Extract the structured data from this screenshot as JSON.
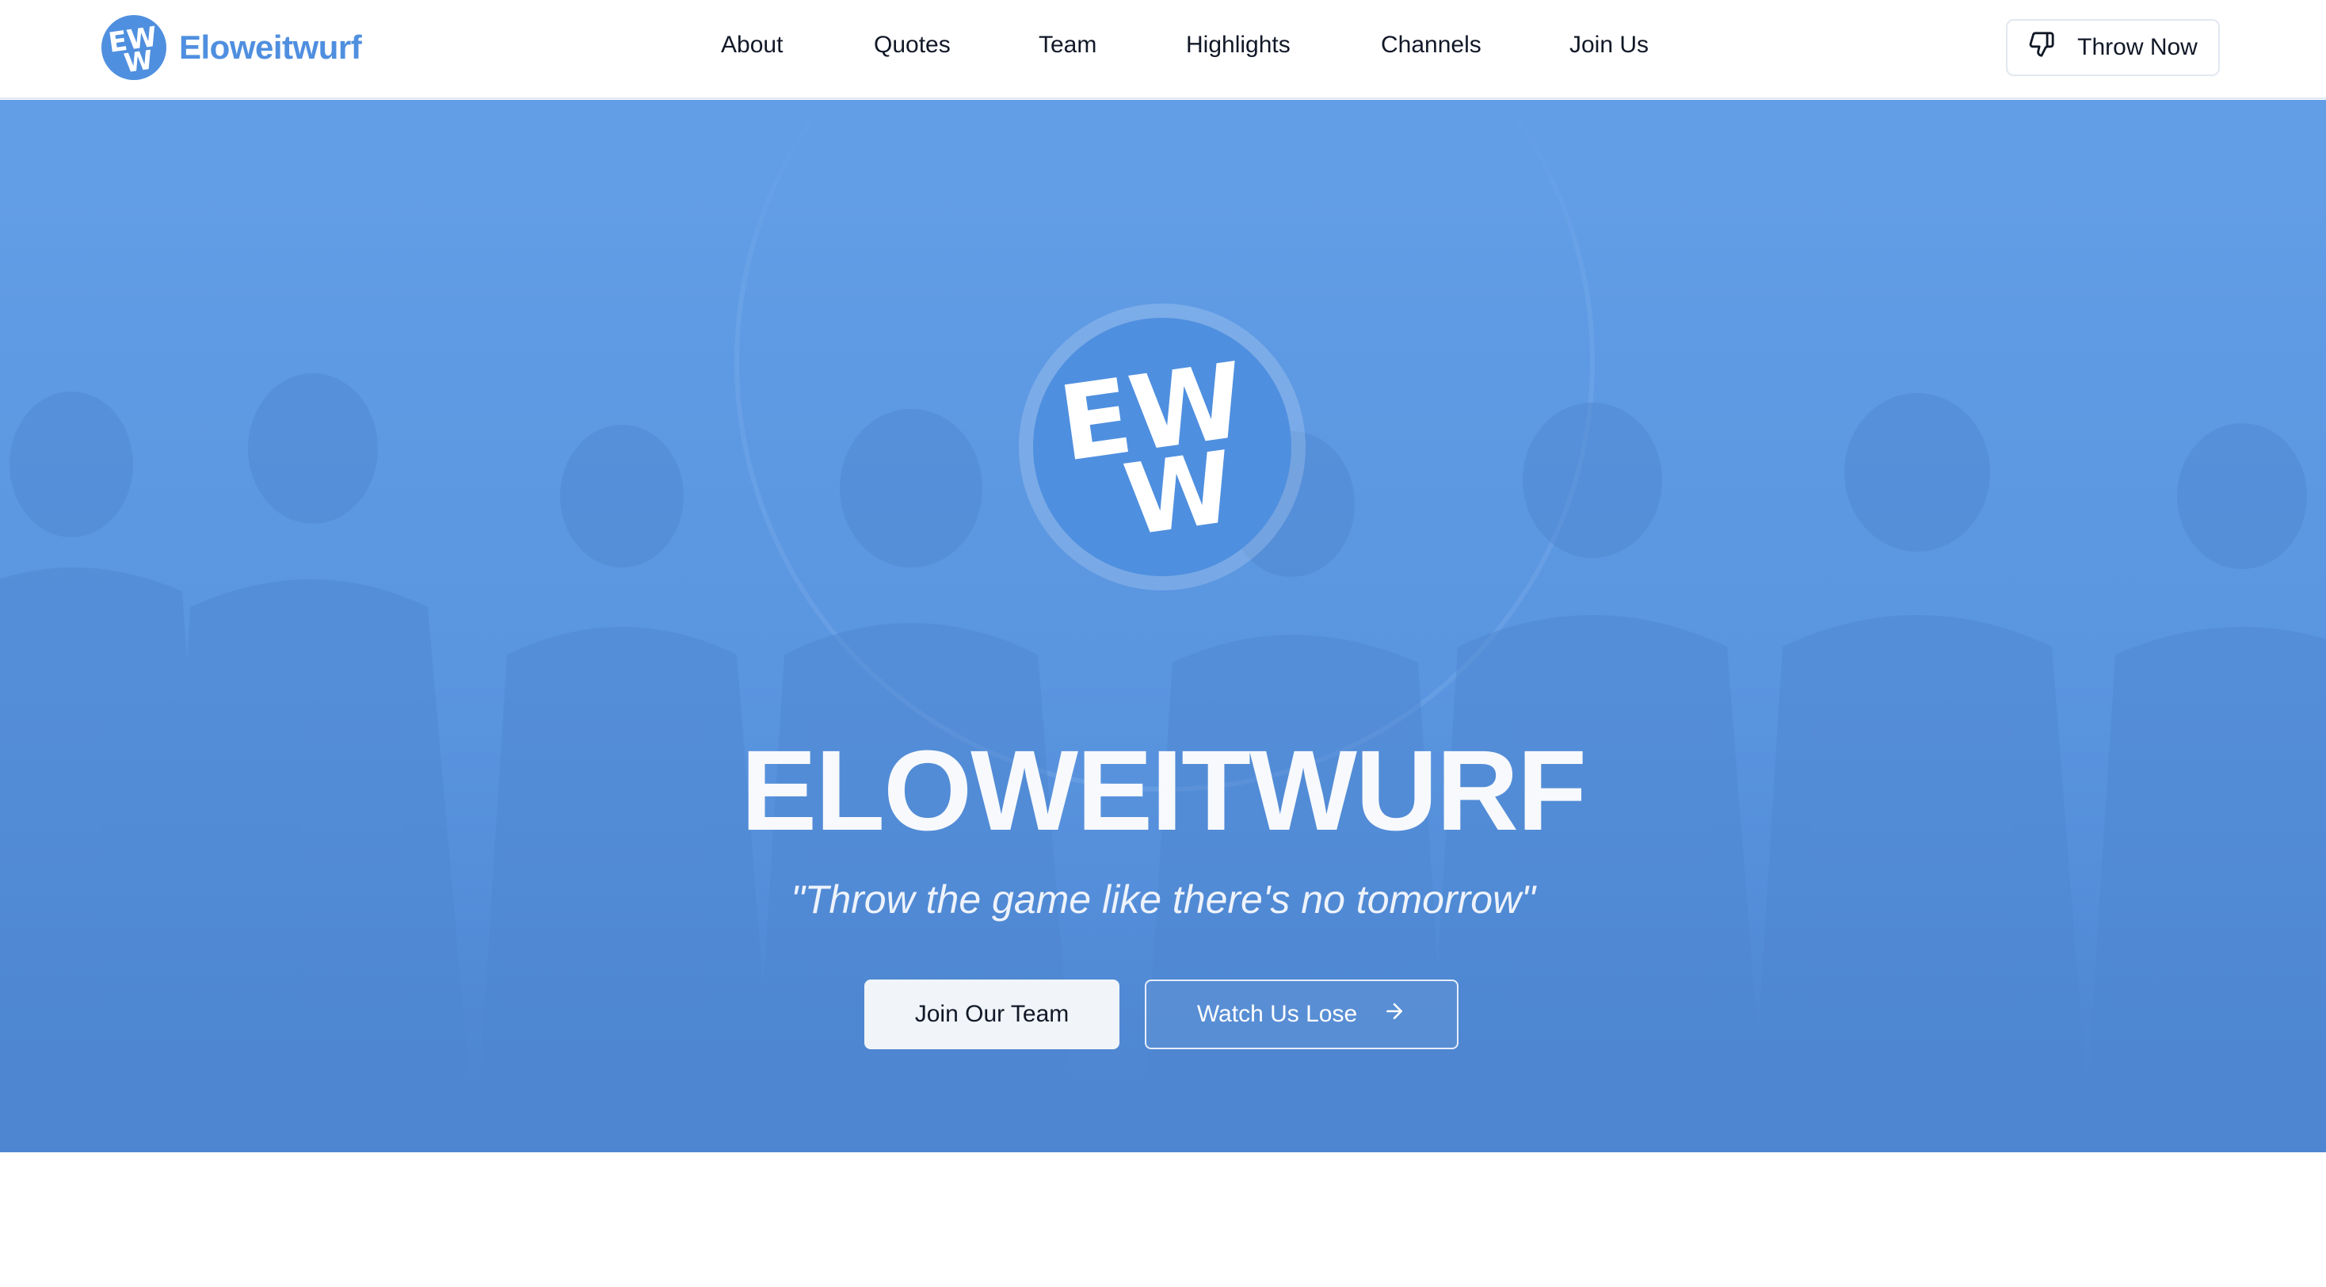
{
  "brand": {
    "name": "Eloweitwurf",
    "logo_letters": "EWW",
    "accent_color": "#4f8fdf"
  },
  "nav": {
    "links": [
      "About",
      "Quotes",
      "Team",
      "Highlights",
      "Channels",
      "Join Us"
    ],
    "cta_label": "Throw Now",
    "cta_icon": "thumbs-down-icon"
  },
  "hero": {
    "title": "ELOWEITWURF",
    "tagline": "\"Throw the game like there's no tomorrow\"",
    "primary_button": "Join Our Team",
    "secondary_button": "Watch Us Lose",
    "secondary_icon": "arrow-right-icon",
    "overlay_color": "#5a95e0"
  }
}
